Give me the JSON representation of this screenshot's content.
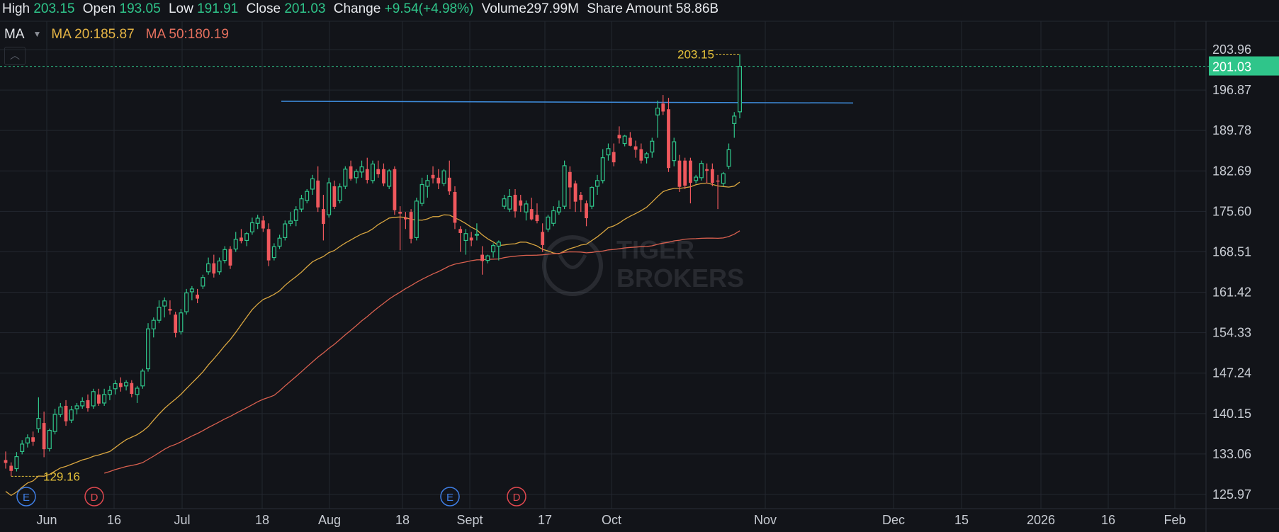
{
  "infobar": {
    "high_label": "High",
    "high": "203.15",
    "open_label": "Open",
    "open": "193.05",
    "low_label": "Low",
    "low": "191.91",
    "close_label": "Close",
    "close": "201.03",
    "change_label": "Change",
    "change": "+9.54(+4.98%)",
    "volume_label": "Volume",
    "volume": "297.99M",
    "amount_label": "Share Amount",
    "amount": "58.86B"
  },
  "ma_bar": {
    "selector": "MA",
    "ma20": "MA 20:185.87",
    "ma50": "MA 50:180.19"
  },
  "colors": {
    "up": "#2fc58a",
    "down": "#f0585d",
    "ma20": "#d9a640",
    "ma50": "#d9604f",
    "trendline": "#3f8fe0",
    "marker": "#e6c23a",
    "grid": "#23272f",
    "background": "#121419"
  },
  "icons": {
    "collapse": "chevron-up-icon"
  },
  "chart_data": {
    "type": "candlestick",
    "ylim": [
      124.5,
      206.0
    ],
    "y_ticks": [
      "203.96",
      "196.87",
      "189.78",
      "182.69",
      "175.60",
      "168.51",
      "161.42",
      "154.33",
      "147.24",
      "140.15",
      "133.06",
      "125.97"
    ],
    "x_ticks": [
      "Jun",
      "16",
      "Jul",
      "18",
      "Aug",
      "18",
      "Sept",
      "17",
      "Oct",
      "Nov",
      "Dec",
      "15",
      "2026",
      "16",
      "Feb"
    ],
    "last_price_label": "201.03",
    "last_price": 201.03,
    "high_marker": {
      "label": "203.15",
      "value": 203.15
    },
    "low_marker": {
      "label": "129.16",
      "value": 129.16
    },
    "events": [
      "E",
      "D",
      "E",
      "D"
    ],
    "trendline": {
      "from": 194.9,
      "to": 194.6
    },
    "series": [
      {
        "name": "MA 20",
        "values": []
      },
      {
        "name": "MA 50",
        "values": []
      }
    ],
    "candles": [
      [
        132.0,
        133.5,
        130.5,
        131.5
      ],
      [
        131.0,
        131.6,
        129.2,
        130.1
      ],
      [
        130.5,
        133.4,
        130.0,
        132.6
      ],
      [
        133.5,
        135.5,
        133.0,
        134.8
      ],
      [
        135.0,
        136.5,
        134.2,
        135.9
      ],
      [
        136.0,
        137.0,
        134.5,
        135.2
      ],
      [
        137.5,
        143.0,
        136.8,
        139.3
      ],
      [
        138.5,
        140.5,
        132.5,
        133.9
      ],
      [
        134.0,
        137.5,
        133.5,
        137.2
      ],
      [
        137.0,
        141.0,
        136.5,
        140.0
      ],
      [
        140.0,
        142.0,
        139.5,
        141.3
      ],
      [
        141.5,
        142.5,
        138.0,
        138.8
      ],
      [
        139.0,
        141.5,
        138.5,
        140.8
      ],
      [
        141.0,
        142.0,
        140.0,
        141.5
      ],
      [
        141.5,
        143.0,
        141.0,
        142.3
      ],
      [
        142.5,
        143.5,
        140.5,
        141.1
      ],
      [
        141.5,
        144.5,
        141.0,
        144.0
      ],
      [
        143.5,
        144.5,
        141.5,
        141.9
      ],
      [
        142.0,
        144.5,
        141.5,
        143.5
      ],
      [
        143.5,
        145.0,
        142.5,
        144.2
      ],
      [
        144.5,
        146.0,
        143.5,
        145.4
      ],
      [
        145.5,
        146.5,
        144.0,
        144.8
      ],
      [
        145.0,
        146.0,
        144.2,
        145.6
      ],
      [
        145.5,
        146.0,
        143.0,
        143.6
      ],
      [
        143.5,
        145.0,
        142.0,
        144.6
      ],
      [
        145.0,
        148.0,
        144.5,
        147.6
      ],
      [
        148.0,
        156.0,
        147.5,
        155.0
      ],
      [
        155.0,
        157.0,
        153.5,
        156.5
      ],
      [
        156.5,
        160.0,
        156.0,
        158.8
      ],
      [
        159.0,
        160.5,
        157.0,
        159.9
      ],
      [
        158.5,
        160.0,
        157.5,
        158.2
      ],
      [
        157.5,
        158.0,
        153.5,
        154.3
      ],
      [
        154.5,
        158.5,
        154.0,
        157.8
      ],
      [
        158.0,
        162.0,
        157.5,
        161.3
      ],
      [
        161.5,
        162.5,
        160.0,
        162.0
      ],
      [
        161.0,
        162.0,
        159.5,
        160.3
      ],
      [
        162.5,
        164.5,
        162.0,
        164.0
      ],
      [
        165.0,
        167.5,
        164.5,
        166.4
      ],
      [
        166.5,
        168.0,
        164.0,
        164.7
      ],
      [
        165.0,
        167.5,
        164.5,
        166.9
      ],
      [
        167.0,
        169.5,
        166.5,
        168.9
      ],
      [
        169.0,
        169.5,
        165.5,
        166.1
      ],
      [
        169.0,
        172.0,
        168.5,
        170.7
      ],
      [
        171.0,
        172.5,
        170.0,
        170.4
      ],
      [
        170.5,
        172.0,
        169.5,
        171.7
      ],
      [
        172.0,
        174.5,
        171.5,
        173.6
      ],
      [
        173.5,
        175.0,
        172.5,
        174.4
      ],
      [
        174.0,
        174.8,
        172.0,
        172.6
      ],
      [
        172.5,
        173.5,
        166.0,
        167.0
      ],
      [
        167.5,
        170.0,
        167.0,
        169.4
      ],
      [
        169.5,
        171.5,
        169.0,
        170.9
      ],
      [
        171.0,
        174.0,
        170.5,
        173.4
      ],
      [
        173.5,
        175.5,
        173.0,
        173.9
      ],
      [
        174.0,
        176.5,
        173.0,
        175.9
      ],
      [
        176.0,
        178.5,
        175.5,
        177.8
      ],
      [
        177.5,
        179.5,
        177.0,
        179.1
      ],
      [
        179.5,
        182.0,
        178.5,
        181.3
      ],
      [
        181.0,
        183.5,
        175.5,
        176.3
      ],
      [
        176.0,
        178.5,
        170.5,
        173.4
      ],
      [
        175.0,
        181.5,
        174.5,
        180.6
      ],
      [
        180.0,
        181.0,
        176.0,
        176.4
      ],
      [
        177.5,
        180.5,
        177.0,
        179.9
      ],
      [
        180.0,
        183.5,
        179.5,
        183.0
      ],
      [
        183.5,
        184.5,
        181.0,
        181.3
      ],
      [
        181.5,
        183.0,
        180.5,
        182.6
      ],
      [
        182.5,
        184.5,
        181.5,
        183.4
      ],
      [
        183.0,
        185.0,
        180.5,
        181.1
      ],
      [
        181.0,
        184.5,
        180.5,
        183.9
      ],
      [
        183.0,
        184.5,
        181.5,
        182.1
      ],
      [
        183.0,
        184.0,
        180.0,
        180.5
      ],
      [
        180.0,
        183.0,
        179.5,
        182.7
      ],
      [
        183.0,
        183.5,
        175.0,
        175.8
      ],
      [
        175.5,
        176.5,
        168.8,
        175.2
      ],
      [
        174.5,
        175.5,
        172.5,
        174.2
      ],
      [
        175.5,
        176.0,
        170.0,
        170.8
      ],
      [
        171.0,
        178.0,
        170.5,
        177.4
      ],
      [
        177.0,
        181.5,
        176.5,
        180.3
      ],
      [
        180.0,
        182.0,
        178.0,
        181.0
      ],
      [
        182.0,
        183.5,
        180.5,
        181.4
      ],
      [
        181.5,
        183.0,
        179.5,
        180.5
      ],
      [
        180.5,
        183.0,
        180.0,
        182.7
      ],
      [
        181.5,
        184.5,
        178.5,
        179.1
      ],
      [
        179.0,
        180.0,
        172.5,
        173.6
      ],
      [
        172.5,
        173.0,
        168.5,
        171.8
      ],
      [
        170.5,
        172.5,
        168.0,
        171.7
      ],
      [
        171.0,
        172.0,
        169.5,
        170.5
      ],
      [
        171.5,
        173.5,
        170.5,
        171.6
      ],
      [
        168.0,
        169.5,
        164.5,
        166.9
      ],
      [
        167.0,
        168.0,
        166.5,
        167.8
      ],
      [
        168.5,
        170.0,
        167.5,
        169.6
      ],
      [
        169.5,
        170.5,
        167.0,
        170.2
      ],
      [
        176.5,
        178.5,
        176.0,
        177.8
      ],
      [
        176.0,
        179.5,
        175.5,
        178.2
      ],
      [
        178.5,
        179.5,
        174.5,
        175.6
      ],
      [
        177.5,
        178.5,
        175.5,
        176.6
      ],
      [
        175.5,
        177.5,
        174.0,
        176.9
      ],
      [
        176.0,
        178.0,
        174.0,
        174.2
      ],
      [
        175.0,
        177.0,
        173.5,
        173.9
      ],
      [
        172.0,
        173.5,
        168.5,
        169.7
      ],
      [
        172.5,
        175.0,
        172.0,
        174.6
      ],
      [
        173.5,
        176.5,
        173.0,
        175.7
      ],
      [
        175.5,
        177.5,
        175.0,
        176.3
      ],
      [
        176.5,
        184.5,
        176.0,
        183.6
      ],
      [
        182.5,
        183.5,
        176.0,
        179.8
      ],
      [
        180.5,
        181.0,
        175.5,
        177.3
      ],
      [
        178.5,
        179.0,
        175.5,
        177.6
      ],
      [
        177.0,
        177.5,
        173.0,
        174.4
      ],
      [
        176.5,
        180.0,
        176.0,
        179.8
      ],
      [
        180.0,
        182.0,
        178.5,
        181.0
      ],
      [
        181.0,
        186.5,
        180.5,
        185.0
      ],
      [
        185.5,
        187.5,
        184.5,
        186.6
      ],
      [
        186.0,
        187.5,
        183.5,
        184.2
      ],
      [
        189.0,
        190.5,
        187.5,
        188.4
      ],
      [
        187.5,
        189.0,
        187.0,
        188.8
      ],
      [
        188.5,
        189.5,
        187.0,
        187.1
      ],
      [
        187.0,
        188.0,
        185.0,
        186.4
      ],
      [
        186.5,
        187.5,
        184.0,
        184.5
      ],
      [
        185.0,
        186.0,
        184.0,
        185.7
      ],
      [
        186.0,
        188.5,
        185.0,
        187.9
      ],
      [
        192.5,
        195.0,
        188.5,
        193.7
      ],
      [
        194.5,
        196.0,
        192.5,
        193.1
      ],
      [
        193.5,
        195.5,
        182.5,
        183.2
      ],
      [
        184.5,
        188.5,
        183.5,
        187.8
      ],
      [
        184.5,
        185.5,
        179.0,
        179.9
      ],
      [
        184.5,
        185.0,
        179.5,
        180.1
      ],
      [
        184.5,
        185.0,
        177.0,
        180.6
      ],
      [
        181.0,
        182.0,
        180.5,
        181.6
      ],
      [
        181.5,
        184.5,
        181.0,
        184.0
      ],
      [
        183.0,
        184.0,
        180.5,
        182.7
      ],
      [
        183.0,
        184.0,
        180.0,
        180.6
      ],
      [
        181.0,
        182.0,
        176.0,
        180.9
      ],
      [
        180.5,
        182.5,
        180.0,
        182.2
      ],
      [
        183.5,
        187.5,
        183.0,
        186.4
      ],
      [
        191.0,
        193.0,
        188.5,
        192.3
      ],
      [
        193.05,
        203.15,
        191.91,
        201.03
      ]
    ]
  }
}
